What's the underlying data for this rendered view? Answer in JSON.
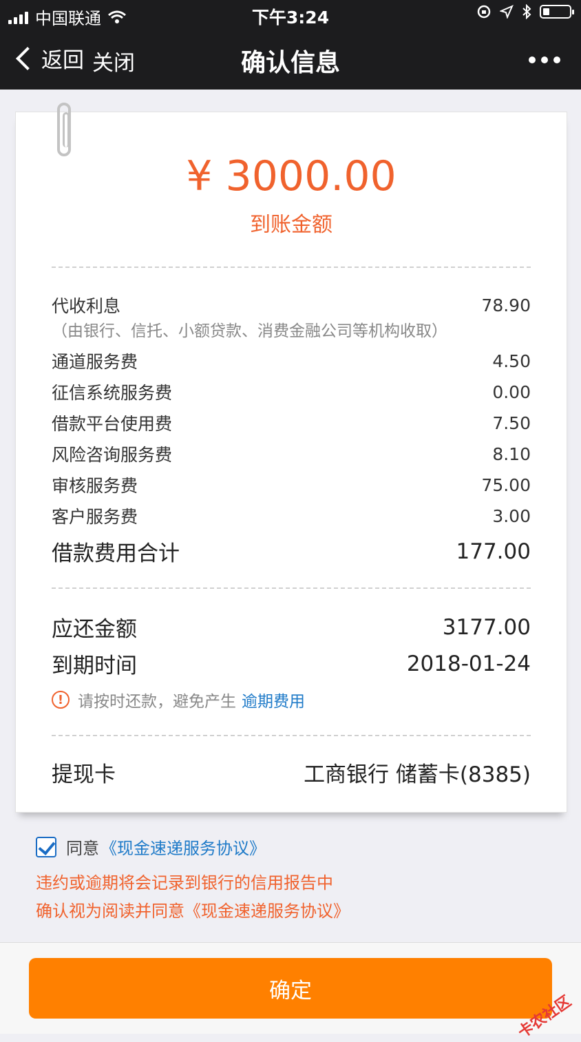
{
  "status_bar": {
    "carrier": "中国联通",
    "time": "下午3:24"
  },
  "nav": {
    "back_label": "返回",
    "close_label": "关闭",
    "title": "确认信息"
  },
  "summary": {
    "amount": "¥ 3000.00",
    "amount_label": "到账金额"
  },
  "fees": {
    "interest": {
      "label": "代收利息",
      "value": "78.90",
      "note": "（由银行、信托、小额贷款、消费金融公司等机构收取）"
    },
    "items": [
      {
        "label": "通道服务费",
        "value": "4.50"
      },
      {
        "label": "征信系统服务费",
        "value": "0.00"
      },
      {
        "label": "借款平台使用费",
        "value": "7.50"
      },
      {
        "label": "风险咨询服务费",
        "value": "8.10"
      },
      {
        "label": "审核服务费",
        "value": "75.00"
      },
      {
        "label": "客户服务费",
        "value": "3.00"
      }
    ],
    "total": {
      "label": "借款费用合计",
      "value": "177.00"
    }
  },
  "repayment": {
    "due_amount_label": "应还金额",
    "due_amount": "3177.00",
    "due_date_label": "到期时间",
    "due_date": "2018-01-24",
    "notice_text": "请按时还款，避免产生",
    "notice_link": "逾期费用"
  },
  "card": {
    "label": "提现卡",
    "value": "工商银行 储蓄卡(8385)"
  },
  "agreement": {
    "checked": true,
    "agree_text": "同意",
    "agree_link": "《现金速递服务协议》",
    "warning_1": "违约或逾期将会记录到银行的信用报告中",
    "warning_2": "确认视为阅读并同意《现金速递服务协议》"
  },
  "footer": {
    "confirm_label": "确定",
    "watermark": "卡农社区"
  },
  "colors": {
    "accent": "#f0622d",
    "button": "#ff8000",
    "link": "#1e7ac8"
  }
}
